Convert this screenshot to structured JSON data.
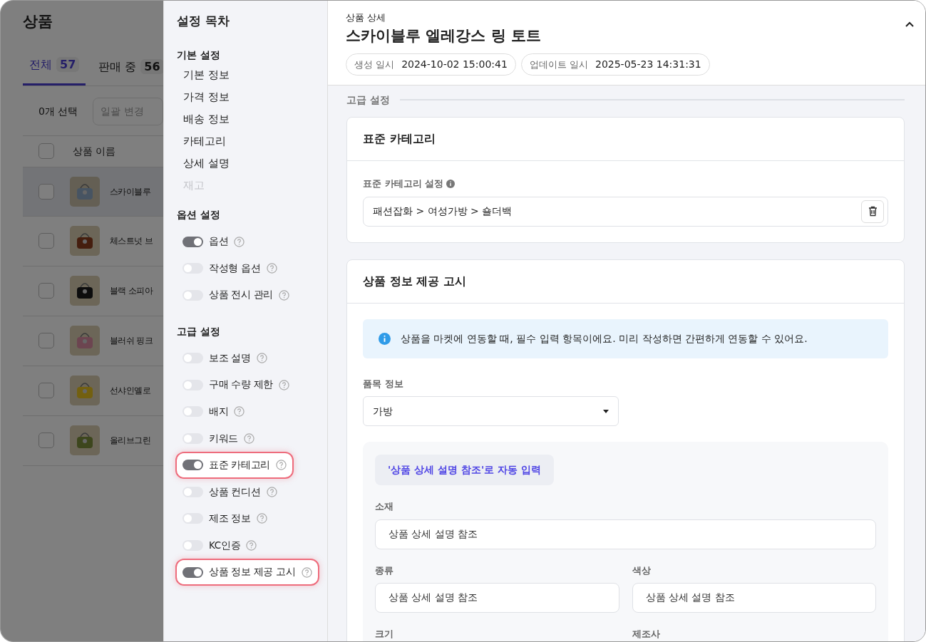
{
  "background_page": {
    "title": "상품",
    "tabs": [
      {
        "label": "전체",
        "count": "57",
        "selected": true
      },
      {
        "label": "판매 중",
        "count": "56",
        "selected": false
      }
    ],
    "selection_count": "0개 선택",
    "bulk_change": {
      "placeholder": "일괄 변경"
    },
    "table": {
      "header_checked": false,
      "columns": [
        "상품 이름"
      ],
      "rows": [
        {
          "name": "스카이블루",
          "selected": true,
          "checked": false
        },
        {
          "name": "체스트넛 브",
          "selected": false,
          "checked": false
        },
        {
          "name": "블랙 소피아",
          "selected": false,
          "checked": false
        },
        {
          "name": "블러쉬 핑크",
          "selected": false,
          "checked": false
        },
        {
          "name": "선샤인옐로",
          "selected": false,
          "checked": false
        },
        {
          "name": "올리브그린",
          "selected": false,
          "checked": false
        }
      ]
    }
  },
  "sidebar": {
    "title": "설정 목차",
    "sections": [
      {
        "title": "기본 설정",
        "items": [
          {
            "kind": "link",
            "label": "기본 정보",
            "disabled": false
          },
          {
            "kind": "link",
            "label": "가격 정보",
            "disabled": false
          },
          {
            "kind": "link",
            "label": "배송 정보",
            "disabled": false
          },
          {
            "kind": "link",
            "label": "카테고리",
            "disabled": false
          },
          {
            "kind": "link",
            "label": "상세 설명",
            "disabled": false
          },
          {
            "kind": "link",
            "label": "재고",
            "disabled": true
          }
        ]
      },
      {
        "title": "옵션 설정",
        "items": [
          {
            "kind": "toggle",
            "label": "옵션",
            "on": true,
            "highlighted": false
          },
          {
            "kind": "toggle",
            "label": "작성형 옵션",
            "on": false,
            "highlighted": false
          },
          {
            "kind": "toggle",
            "label": "상품 전시 관리",
            "on": false,
            "highlighted": false
          }
        ]
      },
      {
        "title": "고급 설정",
        "items": [
          {
            "kind": "toggle",
            "label": "보조 설명",
            "on": false,
            "highlighted": false
          },
          {
            "kind": "toggle",
            "label": "구매 수량 제한",
            "on": false,
            "highlighted": false
          },
          {
            "kind": "toggle",
            "label": "배지",
            "on": false,
            "highlighted": false
          },
          {
            "kind": "toggle",
            "label": "키워드",
            "on": false,
            "highlighted": false
          },
          {
            "kind": "toggle",
            "label": "표준 카테고리",
            "on": true,
            "highlighted": true
          },
          {
            "kind": "toggle",
            "label": "상품 컨디션",
            "on": false,
            "highlighted": false
          },
          {
            "kind": "toggle",
            "label": "제조 정보",
            "on": false,
            "highlighted": false
          },
          {
            "kind": "toggle",
            "label": "KC인증",
            "on": false,
            "highlighted": false
          },
          {
            "kind": "toggle",
            "label": "상품 정보 제공 고시",
            "on": true,
            "highlighted": true
          }
        ]
      }
    ]
  },
  "header": {
    "subtitle": "상품 상세",
    "title": "스카이블루 엘레강스 링 토트",
    "meta": [
      {
        "label": "생성 일시",
        "value": "2024-10-02 15:00:41"
      },
      {
        "label": "업데이트 일시",
        "value": "2025-05-23 14:31:31"
      }
    ]
  },
  "section_divider": "고급 설정",
  "category_card": {
    "title": "표준 카테고리",
    "field_label": "표준 카테고리 설정",
    "value": "패션잡화 > 여성가방 > 숄더백"
  },
  "notice_card": {
    "title": "상품 정보 제공 고시",
    "info": "상품을 마켓에 연동할 때, 필수 입력 항목이에요. 미리 작성하면 간편하게 연동할 수 있어요.",
    "select_label": "품목 정보",
    "select_value": "가방",
    "autofill_button": "'상품 상세 설명 참조'로 자동 입력",
    "fields": [
      {
        "kind": "full",
        "label": "소재",
        "value": "상품 상세 설명 참조"
      },
      {
        "kind": "half",
        "label": "종류",
        "value": "상품 상세 설명 참조"
      },
      {
        "kind": "half",
        "label": "색상",
        "value": "상품 상세 설명 참조"
      },
      {
        "kind": "half",
        "label": "크기"
      },
      {
        "kind": "half",
        "label": "제조사"
      }
    ]
  }
}
